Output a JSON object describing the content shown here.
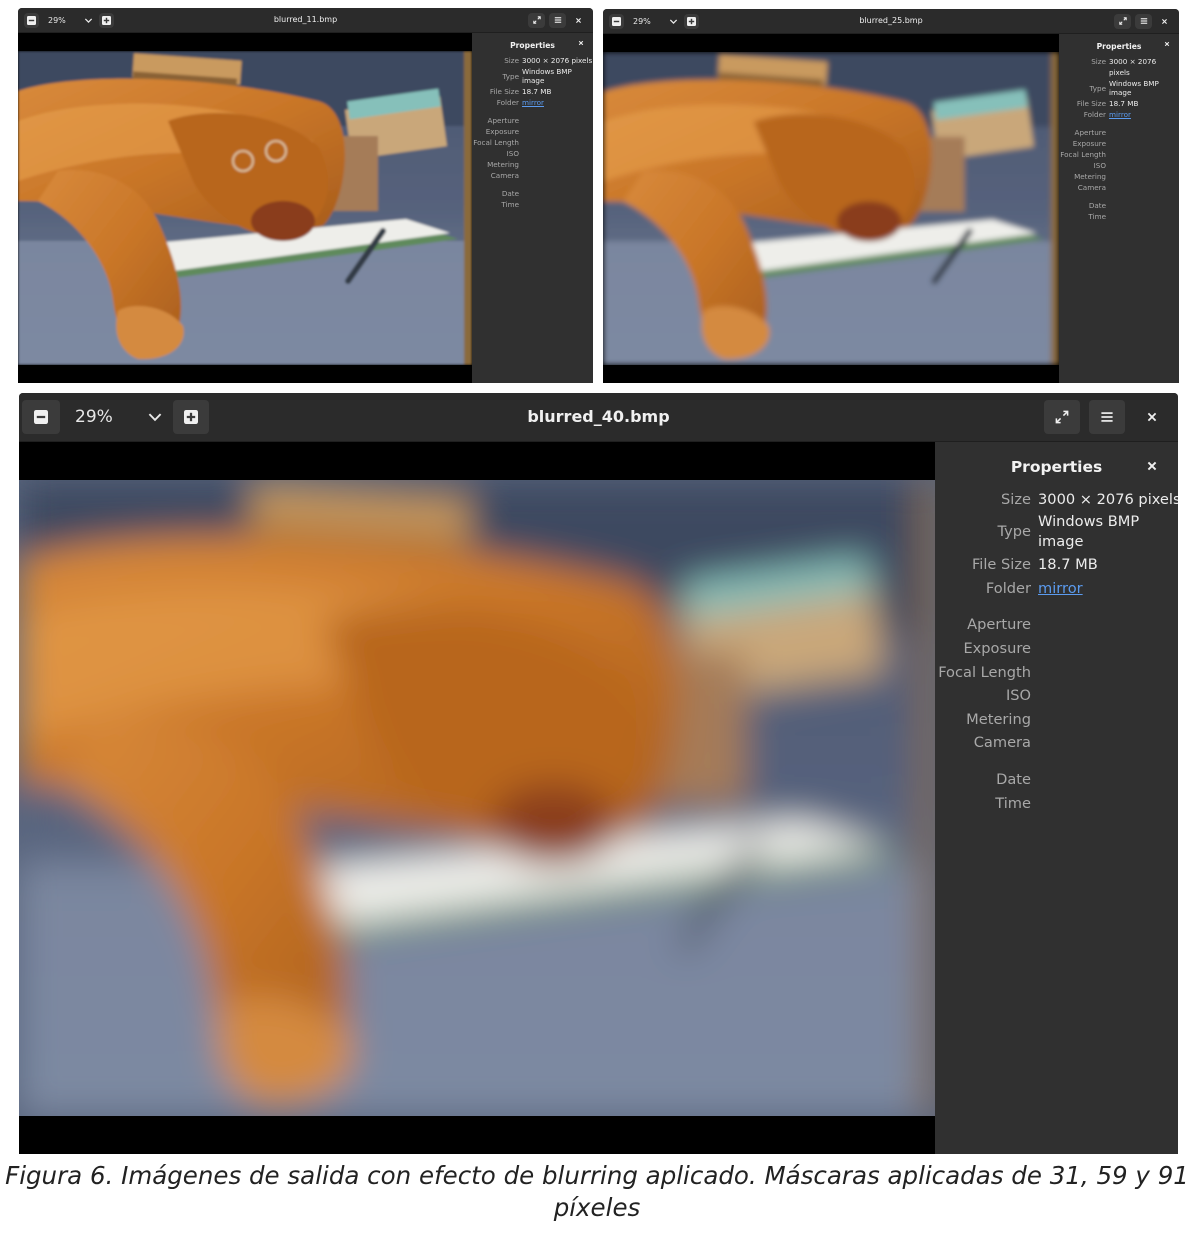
{
  "windows": [
    {
      "id": "small-1",
      "title": "blurred_11.bmp",
      "zoom": "29%",
      "blur_amount": 1.2,
      "panel": {
        "title": "Properties",
        "size_label": "Size",
        "size_value": "3000 × 2076 pixels",
        "type_label": "Type",
        "type_value": "Windows BMP image",
        "filesize_label": "File Size",
        "filesize_value": "18.7 MB",
        "folder_label": "Folder",
        "folder_value": "mirror",
        "aperture_label": "Aperture",
        "exposure_label": "Exposure",
        "focal_label": "Focal Length",
        "iso_label": "ISO",
        "metering_label": "Metering",
        "camera_label": "Camera",
        "date_label": "Date",
        "time_label": "Time"
      }
    },
    {
      "id": "small-2",
      "title": "blurred_25.bmp",
      "zoom": "29%",
      "blur_amount": 3,
      "panel": {
        "title": "Properties",
        "size_label": "Size",
        "size_value": "3000 × 2076 pixels",
        "type_label": "Type",
        "type_value": "Windows BMP image",
        "filesize_label": "File Size",
        "filesize_value": "18.7 MB",
        "folder_label": "Folder",
        "folder_value": "mirror",
        "aperture_label": "Aperture",
        "exposure_label": "Exposure",
        "focal_label": "Focal Length",
        "iso_label": "ISO",
        "metering_label": "Metering",
        "camera_label": "Camera",
        "date_label": "Date",
        "time_label": "Time"
      }
    },
    {
      "id": "large",
      "title": "blurred_40.bmp",
      "zoom": "29%",
      "blur_amount": 9,
      "panel": {
        "title": "Properties",
        "size_label": "Size",
        "size_value": "3000 × 2076 pixels",
        "type_label": "Type",
        "type_value": "Windows BMP image",
        "filesize_label": "File Size",
        "filesize_value": "18.7 MB",
        "folder_label": "Folder",
        "folder_value": "mirror",
        "aperture_label": "Aperture",
        "exposure_label": "Exposure",
        "focal_label": "Focal Length",
        "iso_label": "ISO",
        "metering_label": "Metering",
        "camera_label": "Camera",
        "date_label": "Date",
        "time_label": "Time"
      }
    }
  ],
  "icons": {
    "zoom_out": "minus-square-icon",
    "zoom_menu": "chevron-down-icon",
    "zoom_in": "plus-square-icon",
    "fullscreen": "fullscreen-icon",
    "menu": "hamburger-menu-icon",
    "close": "close-icon"
  },
  "colors": {
    "window_bg": "#2e2e2e",
    "link": "#5b9bef",
    "viewer_bg": "#000000"
  },
  "caption": "Figura 6. Imágenes de salida con efecto de blurring aplicado. Máscaras aplicadas de 31, 59 y 91 píxeles"
}
